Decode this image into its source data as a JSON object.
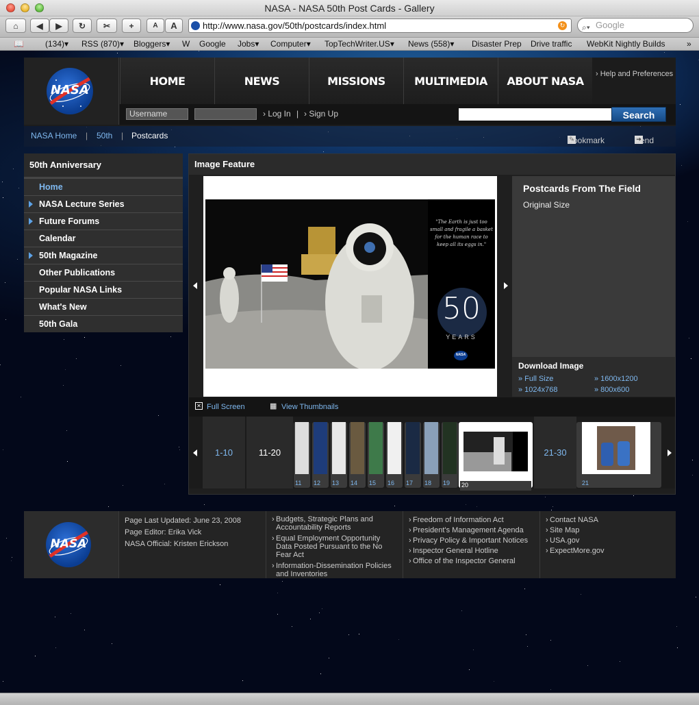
{
  "window": {
    "title": "NASA - NASA 50th Post Cards - Gallery"
  },
  "toolbar": {
    "url": "http://www.nasa.gov/50th/postcards/index.html",
    "search_placeholder": "Google",
    "font_small": "A",
    "font_large": "A"
  },
  "bookmarks": [
    "(134)▾",
    "RSS (870)▾",
    "Bloggers▾",
    "W",
    "Google",
    "Jobs▾",
    "Computer▾",
    "TopTechWriter.US▾",
    "News (558)▾",
    "Disaster Prep",
    "Drive traffic",
    "WebKit Nightly Builds"
  ],
  "header": {
    "logo_text": "NASA",
    "nav": [
      "HOME",
      "NEWS",
      "MISSIONS",
      "MULTIMEDIA",
      "ABOUT NASA"
    ],
    "help": "› Help and Preferences",
    "username_placeholder": "Username",
    "login": "› Log In",
    "sep": "|",
    "signup": "› Sign Up",
    "search_button": "Search"
  },
  "breadcrumb": {
    "home": "NASA Home",
    "sep": "|",
    "fifty": "50th",
    "current": "Postcards",
    "bookmark": "Bookmark",
    "send": "Send"
  },
  "sidebar": {
    "title": "50th Anniversary",
    "items": [
      {
        "label": "Home",
        "arrow": false
      },
      {
        "label": "NASA Lecture Series",
        "arrow": true
      },
      {
        "label": "Future Forums",
        "arrow": true
      },
      {
        "label": "Calendar",
        "arrow": false
      },
      {
        "label": "50th Magazine",
        "arrow": true
      },
      {
        "label": "Other Publications",
        "arrow": false
      },
      {
        "label": "Popular NASA Links",
        "arrow": false
      },
      {
        "label": "What's New",
        "arrow": false
      },
      {
        "label": "50th Gala",
        "arrow": false
      }
    ]
  },
  "feature": {
    "title": "Image Feature",
    "card_quote": "\"The Earth is just too small and fragile a basket for the human race to keep all its eggs in.\"",
    "card_years": "YEARS",
    "card_50": "50",
    "card_logo": "NASA",
    "info_title": "Postcards From The Field",
    "info_sub": "Original Size",
    "download_title": "Download Image",
    "downloads": [
      "» Full Size",
      "» 1600x1200",
      "» 1024x768",
      "» 800x600"
    ],
    "fullscreen": "Full Screen",
    "view_thumbs": "View Thumbnails",
    "page_prev": "1-10",
    "page_cur": "11-20",
    "page_next": "21-30",
    "thumb_nums": [
      "11",
      "12",
      "13",
      "14",
      "15",
      "16",
      "17",
      "18",
      "19"
    ],
    "thumb_selected": "20",
    "thumb_next": "21"
  },
  "footer": {
    "logo_text": "NASA",
    "updated": "Page Last Updated: June 23, 2008",
    "editor": "Page Editor: Erika Vick",
    "official": "NASA Official: Kristen Erickson",
    "col1": [
      "Budgets, Strategic Plans and Accountability Reports",
      "Equal Employment Opportunity Data Posted Pursuant to the No Fear Act",
      "Information-Dissemination Policies and Inventories"
    ],
    "col2": [
      "Freedom of Information Act",
      "President's Management Agenda",
      "Privacy Policy & Important Notices",
      "Inspector General Hotline",
      "Office of the Inspector General"
    ],
    "col3": [
      "Contact NASA",
      "Site Map",
      "USA.gov",
      "ExpectMore.gov"
    ]
  }
}
